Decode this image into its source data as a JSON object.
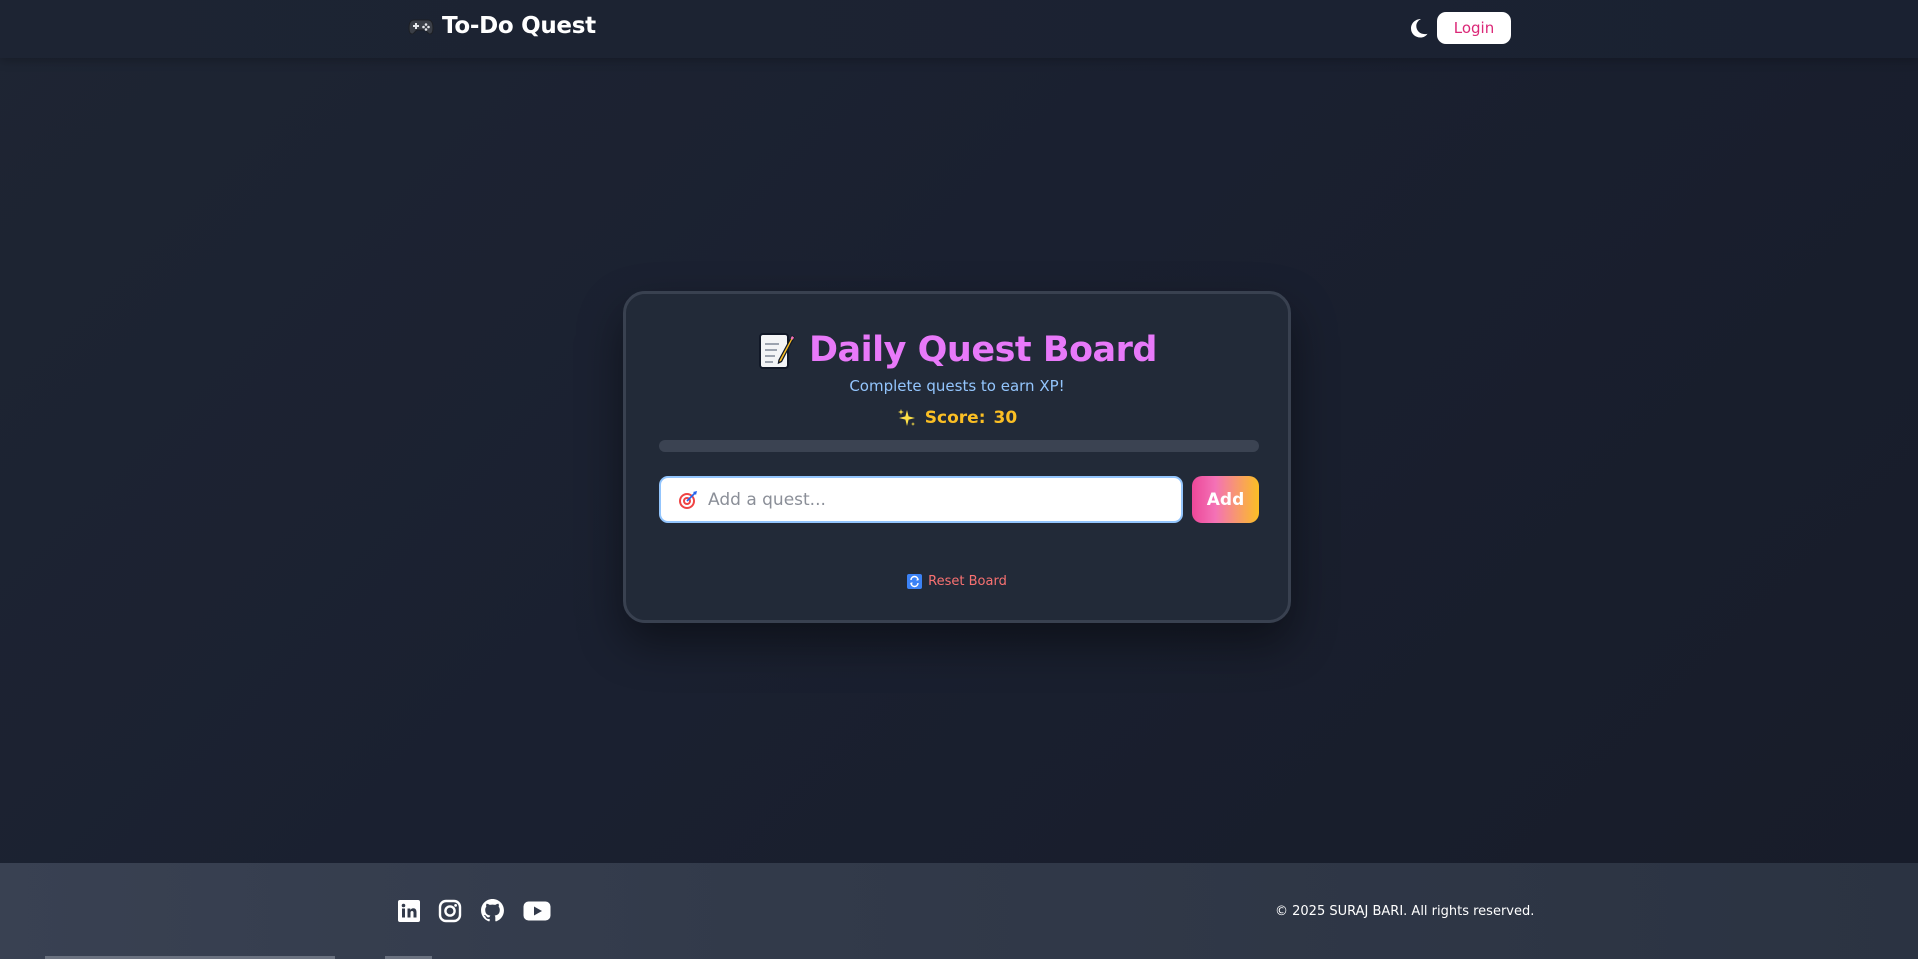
{
  "navbar": {
    "brand_icon": "gamepad-icon",
    "brand_text": "To-Do Quest",
    "theme_toggle_icon": "moon-icon",
    "login_label": "Login"
  },
  "quest_board": {
    "title_icon": "memo-icon",
    "title": "Daily Quest Board",
    "subtitle": "Complete quests to earn XP!",
    "score_icon": "sparkles-icon",
    "score_label": "Score:",
    "score_value": "30",
    "progress_fraction": 0,
    "input_icon": "target-icon",
    "input_placeholder": "Add a quest...",
    "input_value": "",
    "add_label": "Add",
    "reset_icon": "repeat-icon",
    "reset_label": "Reset Board"
  },
  "footer": {
    "socials": [
      {
        "name": "linkedin-icon"
      },
      {
        "name": "instagram-icon"
      },
      {
        "name": "github-icon"
      },
      {
        "name": "youtube-icon"
      }
    ],
    "copyright": "© 2025 SURAJ BARI. All rights reserved."
  },
  "colors": {
    "background": "#1e2533",
    "card_bg": "#222a38",
    "title": "#e879f9",
    "subtitle": "#93c5fd",
    "score": "#fbbf24",
    "login_text": "#db2777",
    "reset_text": "#f87171",
    "add_gradient_start": "#ec4899",
    "add_gradient_end": "#fbbf24"
  }
}
